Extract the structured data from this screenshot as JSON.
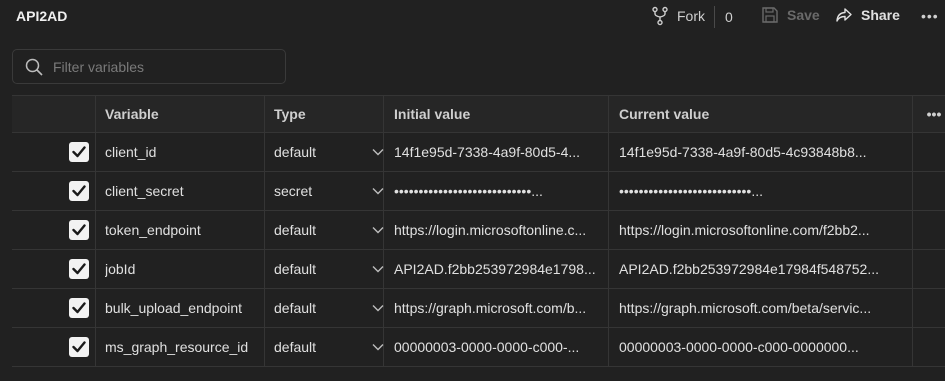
{
  "app": {
    "title": "API2AD"
  },
  "toolbar": {
    "fork_label": "Fork",
    "fork_count": "0",
    "save_label": "Save",
    "share_label": "Share",
    "more_label": "•••"
  },
  "search": {
    "placeholder": "Filter variables"
  },
  "table": {
    "headers": {
      "variable": "Variable",
      "type": "Type",
      "initial": "Initial value",
      "current": "Current value",
      "more": "•••"
    },
    "rows": [
      {
        "checked": true,
        "variable": "client_id",
        "type": "default",
        "initial": "14f1e95d-7338-4a9f-80d5-4...",
        "current": "14f1e95d-7338-4a9f-80d5-4c93848b8..."
      },
      {
        "checked": true,
        "variable": "client_secret",
        "type": "secret",
        "initial": "••••••••••••••••••••••••••••...",
        "current": "•••••••••••••••••••••••••••..."
      },
      {
        "checked": true,
        "variable": "token_endpoint",
        "type": "default",
        "initial": "https://login.microsoftonline.c...",
        "current": "https://login.microsoftonline.com/f2bb2..."
      },
      {
        "checked": true,
        "variable": "jobId",
        "type": "default",
        "initial": "API2AD.f2bb253972984e1798...",
        "current": "API2AD.f2bb253972984e17984f548752..."
      },
      {
        "checked": true,
        "variable": "bulk_upload_endpoint",
        "type": "default",
        "initial": "https://graph.microsoft.com/b...",
        "current": "https://graph.microsoft.com/beta/servic..."
      },
      {
        "checked": true,
        "variable": "ms_graph_resource_id",
        "type": "default",
        "initial": "00000003-0000-0000-c000-...",
        "current": "00000003-0000-0000-c000-0000000..."
      }
    ]
  }
}
